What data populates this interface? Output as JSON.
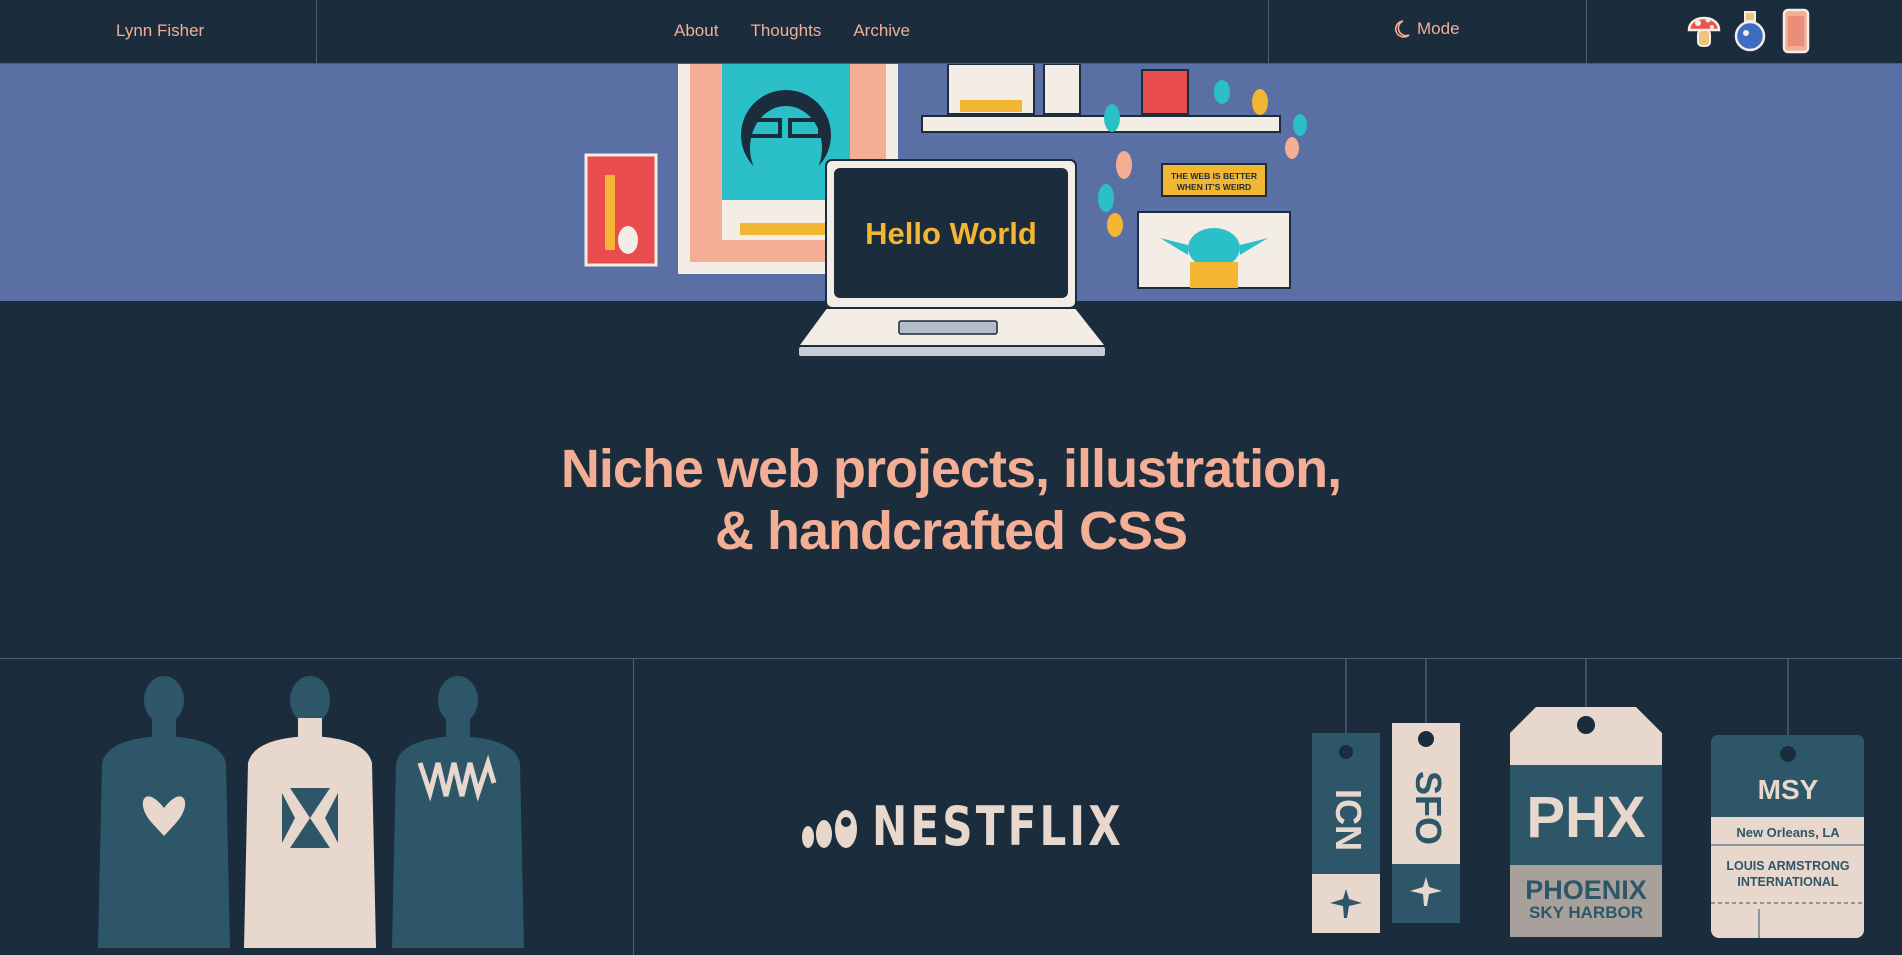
{
  "header": {
    "brand": "Lynn Fisher",
    "nav": [
      "About",
      "Thoughts",
      "Archive"
    ],
    "mode_label": "Mode",
    "badge_icons": [
      "mushroom-badge-icon",
      "potion-badge-icon",
      "phone-badge-icon"
    ]
  },
  "hero": {
    "laptop_screen": "Hello World",
    "sign_line1": "THE WEB IS BETTER",
    "sign_line2": "WHEN IT'S WEIRD",
    "tagline_line1": "Niche web projects, illustration,",
    "tagline_line2": "& handcrafted CSS"
  },
  "projects": {
    "nestflix": "NESTFLIX",
    "tags": {
      "icn": "ICN",
      "sfo": "SFO",
      "phx": "PHX",
      "phx_name1": "PHOENIX",
      "phx_name2": "SKY HARBOR",
      "msy": "MSY",
      "msy_city": "New Orleans, LA",
      "msy_name1": "LOUIS ARMSTRONG",
      "msy_name2": "INTERNATIONAL"
    }
  },
  "colors": {
    "background": "#1b2d3d",
    "band": "#5a6fa3",
    "accent": "#f3ae95",
    "hello": "#f2b632"
  }
}
